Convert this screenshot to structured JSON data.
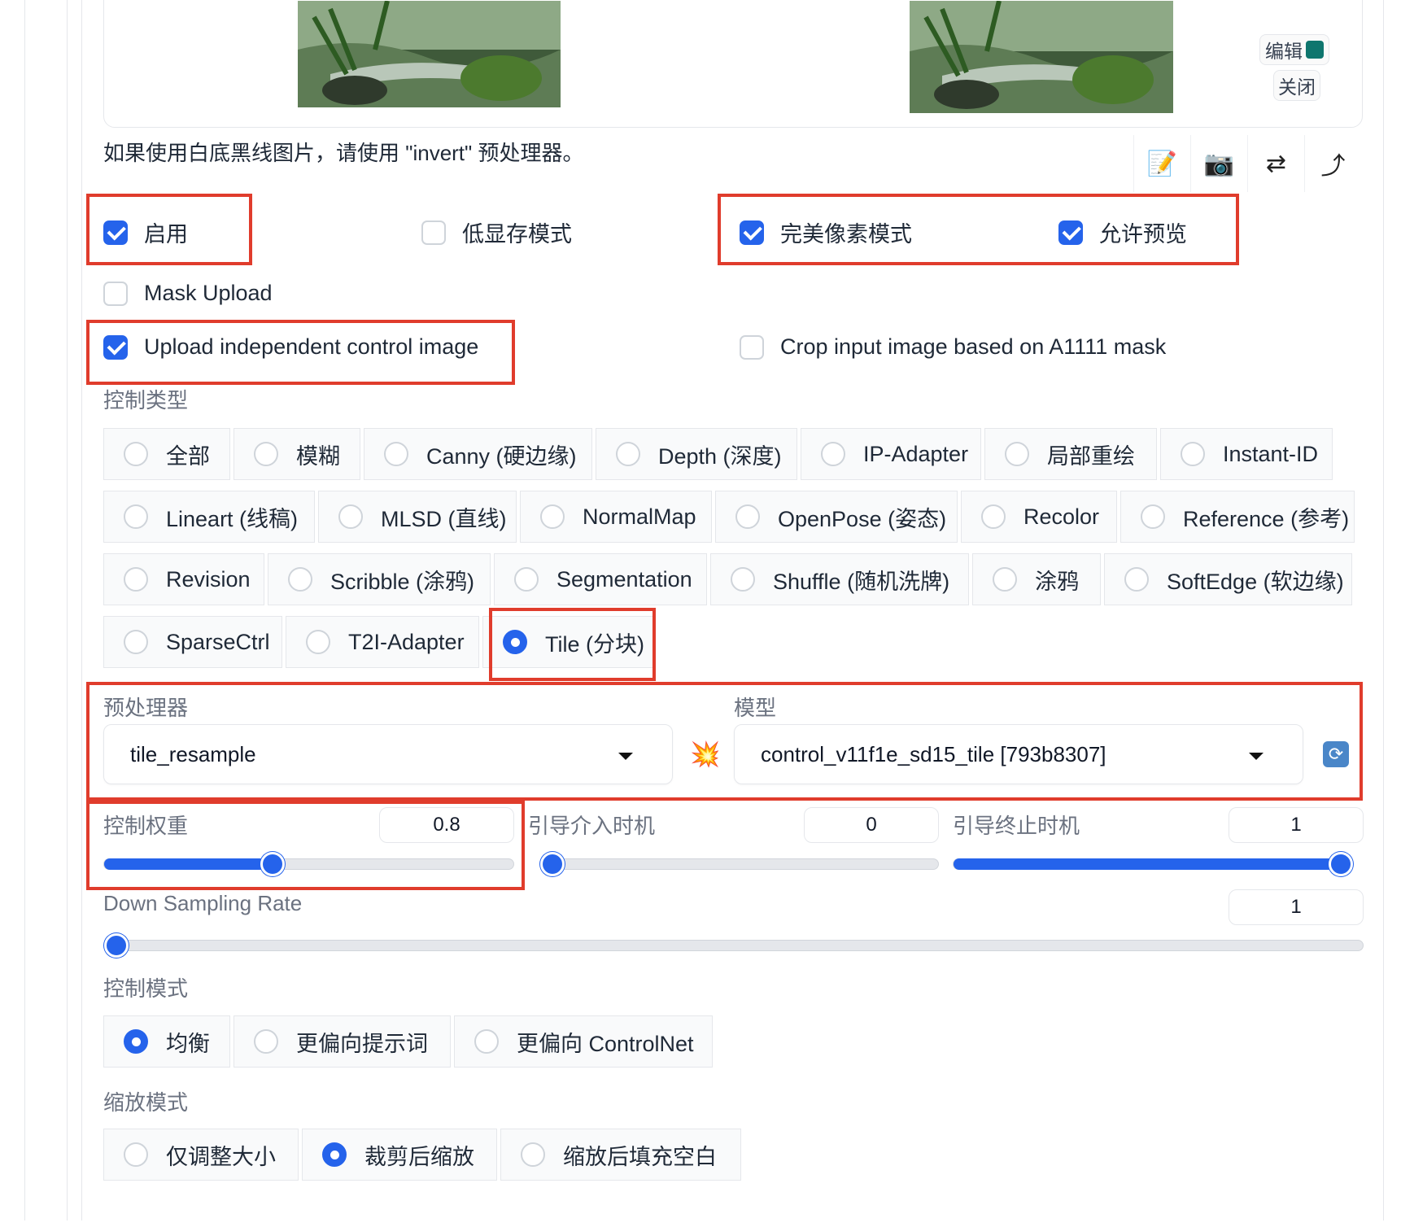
{
  "image_panel": {
    "edit_label": "编辑",
    "close_label": "关闭"
  },
  "note": "如果使用白底黑线图片，请使用 \"invert\" 预处理器。",
  "toolbar": {
    "icons": [
      "memo-icon",
      "camera-icon",
      "swap-icon",
      "upload-arrow-icon"
    ],
    "glyphs": [
      "📝",
      "📷",
      "⇄",
      "⤴"
    ]
  },
  "checkboxes": {
    "enable": {
      "label": "启用",
      "checked": true
    },
    "low_vram": {
      "label": "低显存模式",
      "checked": false
    },
    "pixel_perfect": {
      "label": "完美像素模式",
      "checked": true
    },
    "allow_preview": {
      "label": "允许预览",
      "checked": true
    },
    "mask_upload": {
      "label": "Mask Upload",
      "checked": false
    },
    "upload_independent": {
      "label": "Upload independent control image",
      "checked": true
    },
    "crop_input": {
      "label": "Crop input image based on A1111 mask",
      "checked": false
    }
  },
  "control_type": {
    "label": "控制类型",
    "options": [
      "全部",
      "模糊",
      "Canny (硬边缘)",
      "Depth (深度)",
      "IP-Adapter",
      "局部重绘",
      "Instant-ID",
      "Lineart (线稿)",
      "MLSD (直线)",
      "NormalMap",
      "OpenPose (姿态)",
      "Recolor",
      "Reference (参考)",
      "Revision",
      "Scribble (涂鸦)",
      "Segmentation",
      "Shuffle (随机洗牌)",
      "涂鸦",
      "SoftEdge (软边缘)",
      "SparseCtrl",
      "T2I-Adapter",
      "Tile (分块)"
    ],
    "selected": "Tile (分块)"
  },
  "preprocessor": {
    "label": "预处理器",
    "value": "tile_resample"
  },
  "model": {
    "label": "模型",
    "value": "control_v11f1e_sd15_tile [793b8307]"
  },
  "sliders": {
    "weight": {
      "label": "控制权重",
      "value": "0.8",
      "fraction": 0.41
    },
    "start": {
      "label": "引导介入时机",
      "value": "0",
      "fraction": 0.0
    },
    "end": {
      "label": "引导终止时机",
      "value": "1",
      "fraction": 1.0
    },
    "downsample": {
      "label": "Down Sampling Rate",
      "value": "1",
      "fraction": 0.0
    }
  },
  "control_mode": {
    "label": "控制模式",
    "options": [
      "均衡",
      "更偏向提示词",
      "更偏向 ControlNet"
    ],
    "selected": "均衡"
  },
  "resize_mode": {
    "label": "缩放模式",
    "options": [
      "仅调整大小",
      "裁剪后缩放",
      "缩放后填充空白"
    ],
    "selected": "裁剪后缩放"
  }
}
